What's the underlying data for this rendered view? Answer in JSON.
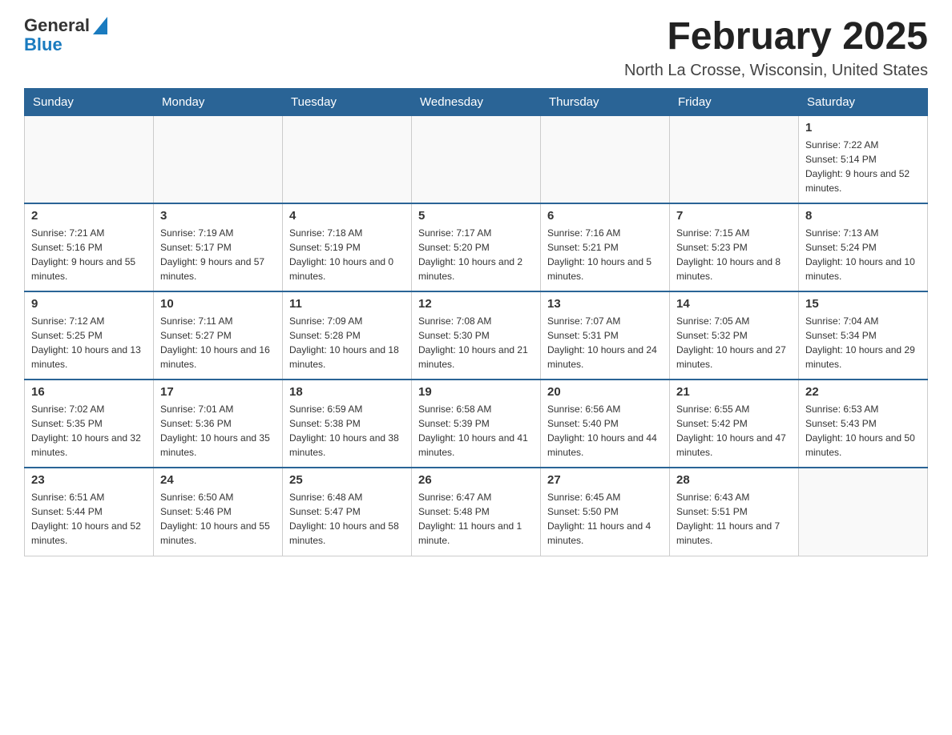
{
  "header": {
    "logo_general": "General",
    "logo_blue": "Blue",
    "month_title": "February 2025",
    "location": "North La Crosse, Wisconsin, United States"
  },
  "weekdays": [
    "Sunday",
    "Monday",
    "Tuesday",
    "Wednesday",
    "Thursday",
    "Friday",
    "Saturday"
  ],
  "weeks": [
    [
      {
        "day": "",
        "info": ""
      },
      {
        "day": "",
        "info": ""
      },
      {
        "day": "",
        "info": ""
      },
      {
        "day": "",
        "info": ""
      },
      {
        "day": "",
        "info": ""
      },
      {
        "day": "",
        "info": ""
      },
      {
        "day": "1",
        "info": "Sunrise: 7:22 AM\nSunset: 5:14 PM\nDaylight: 9 hours and 52 minutes."
      }
    ],
    [
      {
        "day": "2",
        "info": "Sunrise: 7:21 AM\nSunset: 5:16 PM\nDaylight: 9 hours and 55 minutes."
      },
      {
        "day": "3",
        "info": "Sunrise: 7:19 AM\nSunset: 5:17 PM\nDaylight: 9 hours and 57 minutes."
      },
      {
        "day": "4",
        "info": "Sunrise: 7:18 AM\nSunset: 5:19 PM\nDaylight: 10 hours and 0 minutes."
      },
      {
        "day": "5",
        "info": "Sunrise: 7:17 AM\nSunset: 5:20 PM\nDaylight: 10 hours and 2 minutes."
      },
      {
        "day": "6",
        "info": "Sunrise: 7:16 AM\nSunset: 5:21 PM\nDaylight: 10 hours and 5 minutes."
      },
      {
        "day": "7",
        "info": "Sunrise: 7:15 AM\nSunset: 5:23 PM\nDaylight: 10 hours and 8 minutes."
      },
      {
        "day": "8",
        "info": "Sunrise: 7:13 AM\nSunset: 5:24 PM\nDaylight: 10 hours and 10 minutes."
      }
    ],
    [
      {
        "day": "9",
        "info": "Sunrise: 7:12 AM\nSunset: 5:25 PM\nDaylight: 10 hours and 13 minutes."
      },
      {
        "day": "10",
        "info": "Sunrise: 7:11 AM\nSunset: 5:27 PM\nDaylight: 10 hours and 16 minutes."
      },
      {
        "day": "11",
        "info": "Sunrise: 7:09 AM\nSunset: 5:28 PM\nDaylight: 10 hours and 18 minutes."
      },
      {
        "day": "12",
        "info": "Sunrise: 7:08 AM\nSunset: 5:30 PM\nDaylight: 10 hours and 21 minutes."
      },
      {
        "day": "13",
        "info": "Sunrise: 7:07 AM\nSunset: 5:31 PM\nDaylight: 10 hours and 24 minutes."
      },
      {
        "day": "14",
        "info": "Sunrise: 7:05 AM\nSunset: 5:32 PM\nDaylight: 10 hours and 27 minutes."
      },
      {
        "day": "15",
        "info": "Sunrise: 7:04 AM\nSunset: 5:34 PM\nDaylight: 10 hours and 29 minutes."
      }
    ],
    [
      {
        "day": "16",
        "info": "Sunrise: 7:02 AM\nSunset: 5:35 PM\nDaylight: 10 hours and 32 minutes."
      },
      {
        "day": "17",
        "info": "Sunrise: 7:01 AM\nSunset: 5:36 PM\nDaylight: 10 hours and 35 minutes."
      },
      {
        "day": "18",
        "info": "Sunrise: 6:59 AM\nSunset: 5:38 PM\nDaylight: 10 hours and 38 minutes."
      },
      {
        "day": "19",
        "info": "Sunrise: 6:58 AM\nSunset: 5:39 PM\nDaylight: 10 hours and 41 minutes."
      },
      {
        "day": "20",
        "info": "Sunrise: 6:56 AM\nSunset: 5:40 PM\nDaylight: 10 hours and 44 minutes."
      },
      {
        "day": "21",
        "info": "Sunrise: 6:55 AM\nSunset: 5:42 PM\nDaylight: 10 hours and 47 minutes."
      },
      {
        "day": "22",
        "info": "Sunrise: 6:53 AM\nSunset: 5:43 PM\nDaylight: 10 hours and 50 minutes."
      }
    ],
    [
      {
        "day": "23",
        "info": "Sunrise: 6:51 AM\nSunset: 5:44 PM\nDaylight: 10 hours and 52 minutes."
      },
      {
        "day": "24",
        "info": "Sunrise: 6:50 AM\nSunset: 5:46 PM\nDaylight: 10 hours and 55 minutes."
      },
      {
        "day": "25",
        "info": "Sunrise: 6:48 AM\nSunset: 5:47 PM\nDaylight: 10 hours and 58 minutes."
      },
      {
        "day": "26",
        "info": "Sunrise: 6:47 AM\nSunset: 5:48 PM\nDaylight: 11 hours and 1 minute."
      },
      {
        "day": "27",
        "info": "Sunrise: 6:45 AM\nSunset: 5:50 PM\nDaylight: 11 hours and 4 minutes."
      },
      {
        "day": "28",
        "info": "Sunrise: 6:43 AM\nSunset: 5:51 PM\nDaylight: 11 hours and 7 minutes."
      },
      {
        "day": "",
        "info": ""
      }
    ]
  ]
}
